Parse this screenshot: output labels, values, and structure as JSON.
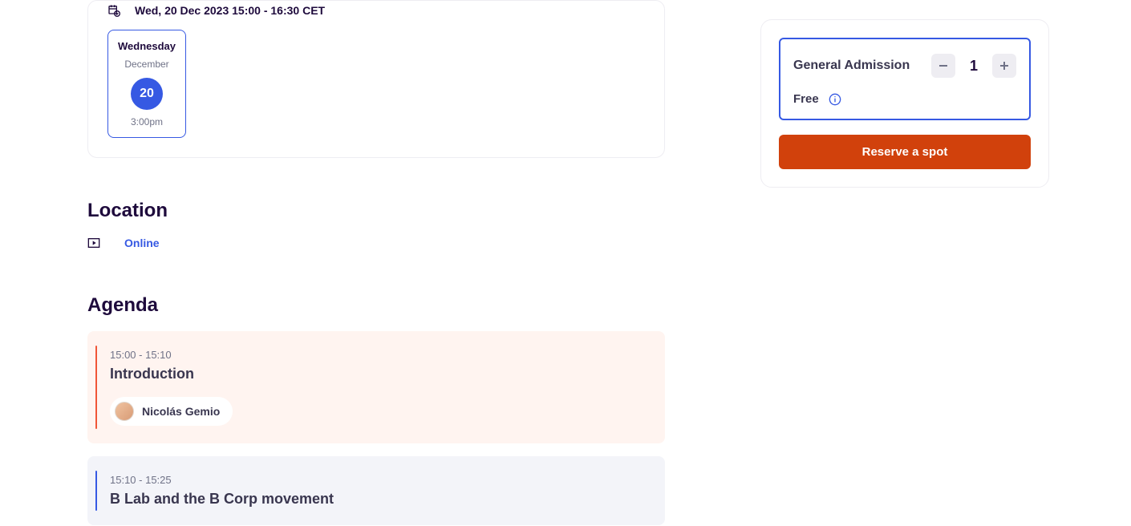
{
  "datetime": {
    "full": "Wed, 20 Dec 2023 15:00 - 16:30 CET",
    "dow": "Wednesday",
    "month": "December",
    "day": "20",
    "time": "3:00pm"
  },
  "location": {
    "heading": "Location",
    "mode": "Online"
  },
  "agenda": {
    "heading": "Agenda",
    "items": [
      {
        "time": "15:00 - 15:10",
        "title": "Introduction",
        "speaker": "Nicolás Gemio"
      },
      {
        "time": "15:10 - 15:25",
        "title": "B Lab and the B Corp movement"
      }
    ]
  },
  "checkout": {
    "ticket_name": "General Admission",
    "quantity": "1",
    "price": "Free",
    "cta": "Reserve a spot"
  }
}
